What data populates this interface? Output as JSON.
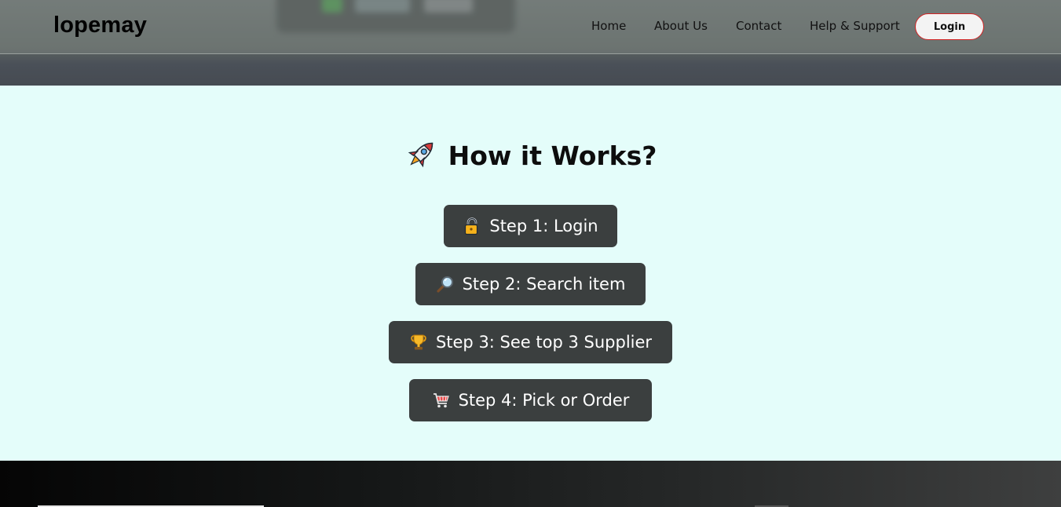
{
  "navbar": {
    "brand": "lopemay",
    "links": [
      "Home",
      "About Us",
      "Contact",
      "Help & Support"
    ],
    "login_label": "Login"
  },
  "how_it_works": {
    "title": "How it Works?",
    "title_icon": "rocket-icon",
    "steps": [
      {
        "label": "Step 1: Login",
        "icon": "lock-icon"
      },
      {
        "label": "Step 2: Search item",
        "icon": "magnifier-icon"
      },
      {
        "label": "Step 3: See top 3 Supplier",
        "icon": "trophy-icon"
      },
      {
        "label": "Step 4: Pick or Order",
        "icon": "cart-icon"
      }
    ]
  },
  "colors": {
    "page_background": "#e4fdfa",
    "step_background": "#3b3f3f",
    "login_border": "#d22323"
  }
}
